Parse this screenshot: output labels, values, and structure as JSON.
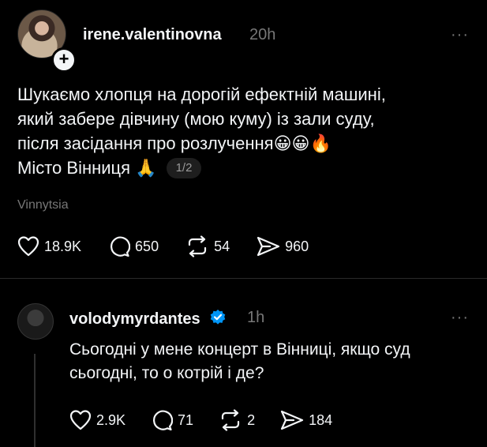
{
  "post": {
    "username": "irene.valentinovna",
    "time": "20h",
    "more": "···",
    "text_lines": [
      "Шукаємо хлопця на дорогій ефектній машині,",
      "який забере дівчину (мою куму) із зали суду,",
      "після засідання про розлучення😀😀🔥",
      "Місто Вінниця 🙏"
    ],
    "page_indicator": "1/2",
    "location": "Vinnytsia",
    "likes": "18.9K",
    "comments": "650",
    "reposts": "54",
    "shares": "960"
  },
  "reply": {
    "username": "volodymyrdantes",
    "time": "1h",
    "more": "···",
    "text_lines": [
      "Сьогодні у мене концерт в Вінниці, якщо суд",
      "сьогодні, то о котрій і де?"
    ],
    "likes": "2.9K",
    "comments": "71",
    "reposts": "2",
    "shares": "184"
  },
  "colors": {
    "background": "#000000",
    "text": "#f3f5f7",
    "muted": "#777777",
    "verified": "#0095f6"
  }
}
